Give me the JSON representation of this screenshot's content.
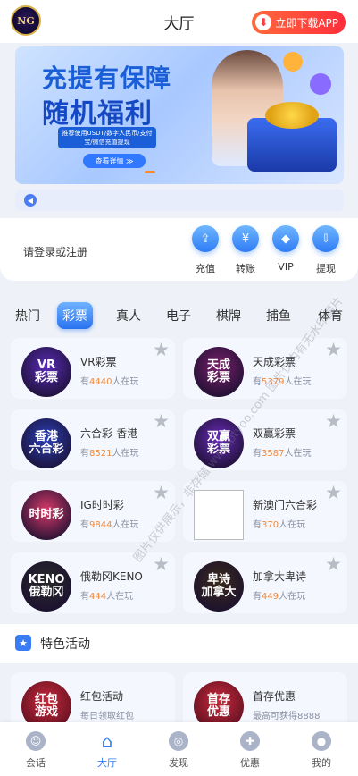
{
  "header": {
    "logo_text": "NG",
    "title": "大厅",
    "download_label": "立即下载APP"
  },
  "banner": {
    "headline_1": "充提有保障",
    "headline_2": "随机福利",
    "subtext": "推荐使用USDT/数字人民币/支付宝/微信充值提现",
    "button_label": "查看详情 ≫"
  },
  "user_panel": {
    "login_prompt": "请登录或注册",
    "actions": [
      {
        "label": "充值",
        "icon": "deposit-icon",
        "glyph": "⇪"
      },
      {
        "label": "转账",
        "icon": "transfer-icon",
        "glyph": "¥"
      },
      {
        "label": "VIP",
        "icon": "vip-diamond-icon",
        "glyph": "◆"
      },
      {
        "label": "提现",
        "icon": "withdraw-icon",
        "glyph": "⇩"
      }
    ]
  },
  "tabs": {
    "items": [
      "热门",
      "彩票",
      "真人",
      "电子",
      "棋牌",
      "捕鱼",
      "体育"
    ],
    "active": "彩票"
  },
  "games": [
    {
      "name": "VR彩票",
      "players": "4440",
      "thumb": "VR\n彩票",
      "color": "#5a2bb8"
    },
    {
      "name": "天成彩票",
      "players": "5379",
      "thumb": "天成\n彩票",
      "color": "#7a1f6b"
    },
    {
      "name": "六合彩-香港",
      "players": "8521",
      "thumb": "香港\n六合彩",
      "color": "#2b3fb8"
    },
    {
      "name": "双赢彩票",
      "players": "3587",
      "thumb": "双赢\n彩票",
      "color": "#6a2bb8"
    },
    {
      "name": "IG时时彩",
      "players": "9844",
      "thumb": "时时彩",
      "color": "#d83a6a"
    },
    {
      "name": "新澳门六合彩",
      "players": "370",
      "thumb": "",
      "color": "#ffffff"
    },
    {
      "name": "俄勒冈KENO",
      "players": "444",
      "thumb": "KENO\n俄勒冈",
      "color": "#2a2a2a"
    },
    {
      "name": "加拿大卑诗",
      "players": "449",
      "thumb": "卑诗\n加拿大",
      "color": "#3a2a1a"
    }
  ],
  "players_prefix": "有",
  "players_suffix": "人在玩",
  "section": {
    "title": "特色活动"
  },
  "promos": [
    {
      "title": "红包活动",
      "desc": "每日领取红包",
      "thumb": "红包\n游戏",
      "color": "#c8283a"
    },
    {
      "title": "首存优惠",
      "desc": "最高可获得8888",
      "thumb": "首存\n优惠",
      "color": "#c8283a"
    }
  ],
  "bottom_nav": [
    {
      "label": "会话",
      "icon": "chat-icon",
      "glyph": "☺"
    },
    {
      "label": "大厅",
      "icon": "home-icon",
      "glyph": "⌂"
    },
    {
      "label": "发现",
      "icon": "discover-icon",
      "glyph": "◎"
    },
    {
      "label": "优惠",
      "icon": "gift-icon",
      "glyph": "✚"
    },
    {
      "label": "我的",
      "icon": "profile-icon",
      "glyph": "●"
    }
  ],
  "watermark": "图片仅供展示，非存储 www.ptyoo.com 图片仅内有无水印图片"
}
